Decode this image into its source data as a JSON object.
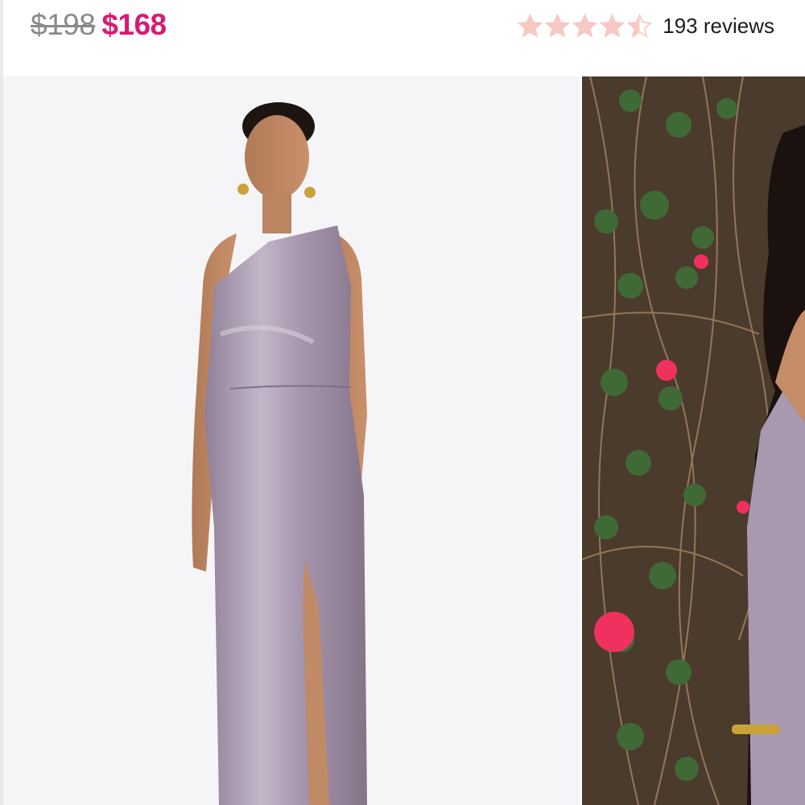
{
  "product": {
    "price_original": "$198",
    "price_sale": "$168",
    "rating": 4.5,
    "rating_max": 5,
    "reviews_label": "193 reviews"
  },
  "colors": {
    "sale_price": "#d81b72",
    "original_price": "#8a8a8a",
    "star": "#f7c8c4",
    "dress": "#a999b0"
  },
  "gallery": {
    "images": [
      {
        "name": "main-product-photo",
        "subject": "model in lilac one-shoulder satin gown"
      },
      {
        "name": "lifestyle-photo",
        "subject": "model in gown by flowering vines"
      }
    ]
  }
}
